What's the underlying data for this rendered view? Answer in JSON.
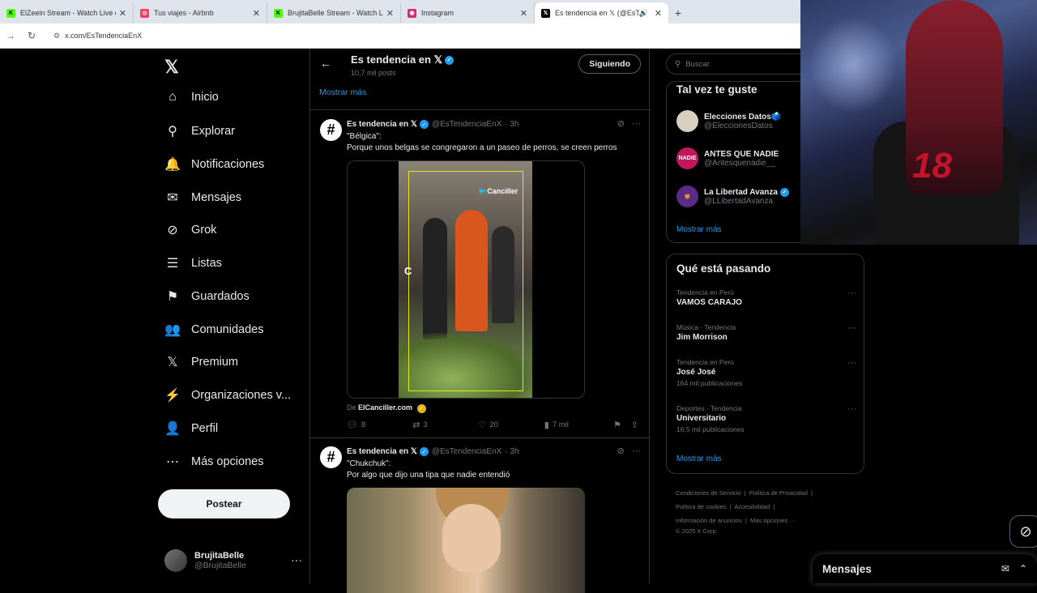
{
  "browser": {
    "tabs": [
      {
        "label": "ElZeein Stream - Watch Live on",
        "fav": "K",
        "color": "#53fc18",
        "close": "✕"
      },
      {
        "label": "Tus viajes - Airbnb",
        "fav": "◎",
        "color": "#ff385c",
        "close": "✕"
      },
      {
        "label": "BrujitaBelle Stream - Watch Live",
        "fav": "K",
        "color": "#53fc18",
        "close": "✕"
      },
      {
        "label": "Instagram",
        "fav": "◉",
        "color": "#d62976",
        "close": "✕"
      },
      {
        "label": "Es tendencia en 𝕏 (@EsTen",
        "fav": "𝕏",
        "color": "#000000",
        "close": "✕"
      }
    ],
    "new_tab": "+",
    "url": "x.com/EsTendenciaEnX"
  },
  "sidebar": {
    "logo": "𝕏",
    "items": [
      {
        "label": "Inicio",
        "icon": "⌂"
      },
      {
        "label": "Explorar",
        "icon": "⚲"
      },
      {
        "label": "Notificaciones",
        "icon": "🔔"
      },
      {
        "label": "Mensajes",
        "icon": "✉"
      },
      {
        "label": "Grok",
        "icon": "⊘"
      },
      {
        "label": "Listas",
        "icon": "☰"
      },
      {
        "label": "Guardados",
        "icon": "⚑"
      },
      {
        "label": "Comunidades",
        "icon": "👥"
      },
      {
        "label": "Premium",
        "icon": "𝕏"
      },
      {
        "label": "Organizaciones v...",
        "icon": "⚡"
      },
      {
        "label": "Perfil",
        "icon": "👤"
      },
      {
        "label": "Más opciones",
        "icon": "⋯"
      }
    ],
    "post_button": "Postear",
    "user": {
      "name": "BrujitaBelle",
      "handle": "@BrujitaBelle",
      "dots": "···"
    }
  },
  "main": {
    "back": "←",
    "title": "Es tendencia en 𝕏",
    "subtitle": "10,7 mil posts",
    "follow_button": "Siguiendo",
    "show_more": "Mostrar más",
    "tweets": [
      {
        "name": "Es tendencia en 𝕏",
        "handle": "@EsTendenciaEnX",
        "time": "· 3h",
        "line1": "\"Bélgica\":",
        "line2": "Porque unos belgas se congregaron a un paseo de perros, se creen perros",
        "watermark": "🐦Canciller",
        "caption_letter": "C",
        "source_prefix": "De ",
        "source": "ElCanciller.com",
        "replies": "8",
        "reposts": "3",
        "likes": "20",
        "views": "7 mil"
      },
      {
        "name": "Es tendencia en 𝕏",
        "handle": "@EsTendenciaEnX",
        "time": "· 3h",
        "line1": "\"Chukchuk\":",
        "line2": "Por algo que dijo una tipa que nadie entendió"
      }
    ]
  },
  "right": {
    "search_placeholder": "Buscar",
    "suggest_title": "Tal vez te guste",
    "suggestions": [
      {
        "name": "Elecciones Datos🗳️",
        "handle": "@EleccionesDatos",
        "avatar_color": "#d9cfc0",
        "verified": false
      },
      {
        "name": "ANTES QUE NADIE",
        "handle": "@Antesquenadie__",
        "avatar_color": "#c2185b",
        "verified": false
      },
      {
        "name": "La Libertad Avanza",
        "handle": "@LLibertadAvanza",
        "avatar_color": "#5b2a86",
        "verified": true
      }
    ],
    "suggest_more": "Mostrar más",
    "trends_title": "Qué está pasando",
    "trends": [
      {
        "context": "Tendencia en Perú",
        "title": "VAMOS CARAJO",
        "posts": ""
      },
      {
        "context": "Música · Tendencia",
        "title": "Jim Morrison",
        "posts": ""
      },
      {
        "context": "Tendencia en Perú",
        "title": "José José",
        "posts": "164 mil publicaciones"
      },
      {
        "context": "Deportes · Tendencia",
        "title": "Universitario",
        "posts": "16,5 mil publicaciones"
      }
    ],
    "trends_more": "Mostrar más",
    "footer": [
      "Condiciones de Servicio",
      "Política de Privacidad",
      "Política de cookies",
      "Accesibilidad",
      "Información de anuncios",
      "Más opciones ···",
      "© 2025 X Corp."
    ]
  },
  "messages_dock": {
    "label": "Mensajes"
  },
  "overlay": {
    "logo_text": "18"
  }
}
